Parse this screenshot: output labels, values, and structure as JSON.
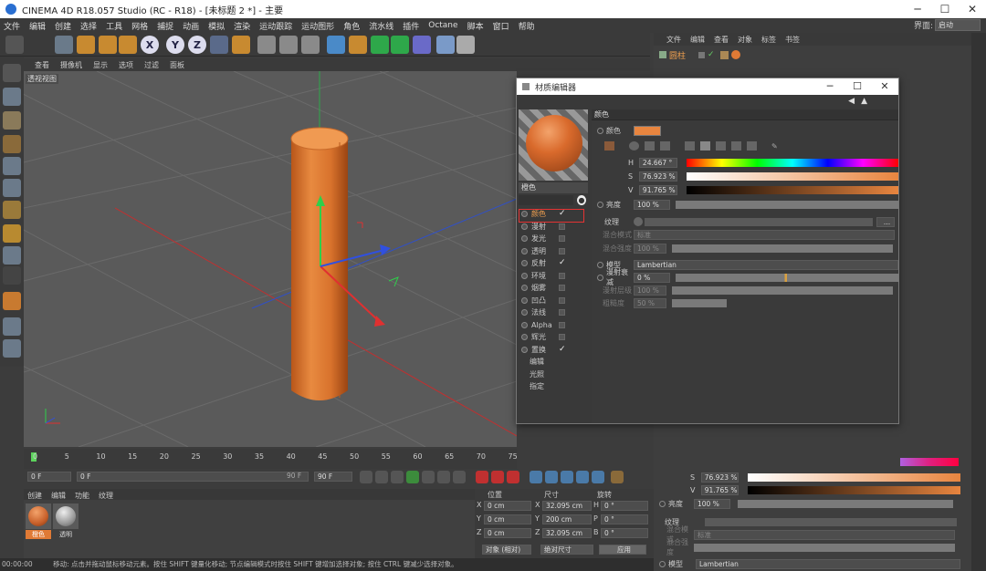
{
  "window": {
    "title": "CINEMA 4D R18.057 Studio (RC - R18) - [未标题 2 *] - 主要"
  },
  "menu": [
    "文件",
    "编辑",
    "创建",
    "选择",
    "工具",
    "网格",
    "捕捉",
    "动画",
    "模拟",
    "渲染",
    "运动跟踪",
    "运动图形",
    "角色",
    "流水线",
    "插件",
    "Octane",
    "脚本",
    "窗口",
    "帮助"
  ],
  "layout": {
    "label": "界面:",
    "value": "启动"
  },
  "toolbar_icons": [
    "undo-icon",
    "live-select-icon",
    "move-icon",
    "scale-icon",
    "rotate-icon",
    "axis-x-icon",
    "axis-y-icon",
    "axis-z-icon",
    "coord-system-icon",
    "render-view-icon",
    "render-picture-icon",
    "render-settings-icon",
    "cube-icon",
    "pen-icon",
    "subdivision-icon",
    "array-icon",
    "deformer-icon",
    "floor-icon",
    "camera-icon",
    "light-icon"
  ],
  "axis_letters": {
    "x": "X",
    "y": "Y",
    "z": "Z"
  },
  "viewport": {
    "menu": [
      "查看",
      "摄像机",
      "显示",
      "选项",
      "过滤",
      "面板"
    ],
    "label": "透视视图"
  },
  "timeline": {
    "ticks": [
      "0",
      "5",
      "10",
      "15",
      "20",
      "25",
      "30",
      "35",
      "40",
      "45",
      "50",
      "55",
      "60",
      "65",
      "70",
      "75"
    ],
    "current_frame": "0 F",
    "start_frame": "0 F",
    "end_frame_mini": "90 F",
    "end_frame": "90 F"
  },
  "material_manager": {
    "menu": [
      "创建",
      "编辑",
      "功能",
      "纹理"
    ],
    "materials": [
      {
        "name": "橙色",
        "color": "#e07a35"
      },
      {
        "name": "透明",
        "color": "#9a9a9a"
      }
    ]
  },
  "coordinates": {
    "headers": [
      "位置",
      "尺寸",
      "旋转"
    ],
    "rows": [
      {
        "axis": "X",
        "pos": "0 cm",
        "size": "32.095 cm",
        "rot_axis": "H",
        "rot": "0 °"
      },
      {
        "axis": "Y",
        "pos": "0 cm",
        "size": "200 cm",
        "rot_axis": "P",
        "rot": "0 °"
      },
      {
        "axis": "Z",
        "pos": "0 cm",
        "size": "32.095 cm",
        "rot_axis": "B",
        "rot": "0 °"
      }
    ],
    "mode_select": "对象 (相对)",
    "size_select": "绝对尺寸",
    "apply_label": "应用"
  },
  "status": {
    "time": "00:00:00",
    "text": "移动: 点击并拖动鼠标移动元素。按住 SHIFT 键量化移动; 节点编辑模式时按住 SHIFT 键增加选择对象; 按住 CTRL 键减少选择对象。"
  },
  "object_manager": {
    "menu": [
      "文件",
      "编辑",
      "查看",
      "对象",
      "标签",
      "书签"
    ],
    "object_name": "圆柱"
  },
  "attr_bg": {
    "s_label": "S",
    "s_value": "76.923 %",
    "v_label": "V",
    "v_value": "91.765 %",
    "brightness_label": "亮度",
    "brightness_value": "100 %",
    "texture_label": "纹理",
    "blend_mode_label": "混合模式",
    "blend_mode_value": "标准",
    "blend_strength_label": "混合强度",
    "model_label": "模型",
    "model_value": "Lambertian"
  },
  "material_editor": {
    "title": "材质编辑器",
    "material_name": "橙色",
    "channels": [
      {
        "name": "颜色",
        "checked": true
      },
      {
        "name": "漫射",
        "checked": false
      },
      {
        "name": "发光",
        "checked": false
      },
      {
        "name": "透明",
        "checked": false
      },
      {
        "name": "反射",
        "checked": true
      },
      {
        "name": "环境",
        "checked": false
      },
      {
        "name": "烟雾",
        "checked": false
      },
      {
        "name": "凹凸",
        "checked": false
      },
      {
        "name": "法线",
        "checked": false
      },
      {
        "name": "Alpha",
        "checked": false
      },
      {
        "name": "辉光",
        "checked": false
      },
      {
        "name": "置换",
        "checked": true
      }
    ],
    "extra_items": [
      "编辑",
      "光照",
      "指定"
    ],
    "section_title": "颜色",
    "color_label": "颜色",
    "swatch_color": "#e8853f",
    "h_label": "H",
    "h_value": "24.667 °",
    "s_label": "S",
    "s_value": "76.923 %",
    "v_label": "V",
    "v_value": "91.765 %",
    "brightness_label": "亮度",
    "brightness_value": "100 %",
    "texture_label": "纹理",
    "blend_mode_label": "混合模式",
    "blend_mode_value": "标准",
    "blend_strength_label": "混合强度",
    "blend_strength_value": "100 %",
    "model_label": "模型",
    "model_value": "Lambertian",
    "diffuse_falloff_label": "漫射衰减",
    "diffuse_falloff_value": "0 %",
    "diffuse_level_label": "漫射层级",
    "diffuse_level_value": "100 %",
    "roughness_label": "粗糙度",
    "roughness_value": "50 %"
  }
}
